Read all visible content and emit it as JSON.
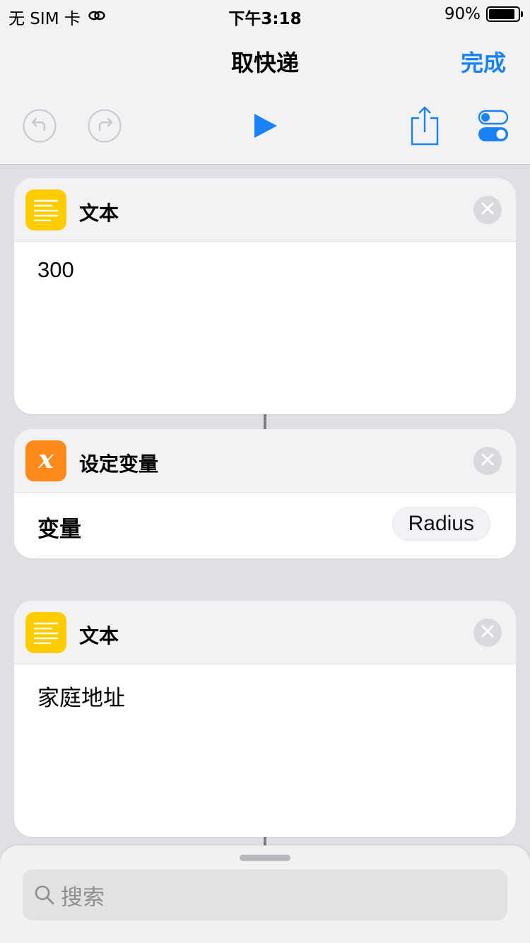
{
  "status_bar": {
    "carrier": "无 SIM 卡",
    "time": "下午3:18",
    "battery_percent": "90%",
    "battery_level": 0.9
  },
  "nav": {
    "title": "取快递",
    "done_label": "完成"
  },
  "toolbar": {
    "icons": [
      "undo-icon",
      "redo-icon",
      "play-icon",
      "share-icon",
      "settings-toggle-icon"
    ],
    "accent_color": "#1a82f7"
  },
  "actions": [
    {
      "title": "文本",
      "icon": "text-lines-icon",
      "color": "#ffcc00",
      "content": "300"
    },
    {
      "title": "设定变量",
      "icon": "variable-x-icon",
      "color": "#ff8a1c",
      "field_label": "变量",
      "field_value": "Radius"
    },
    {
      "title": "文本",
      "icon": "text-lines-icon",
      "color": "#ffcc00",
      "content": "家庭地址"
    }
  ],
  "search": {
    "placeholder": "搜索"
  }
}
